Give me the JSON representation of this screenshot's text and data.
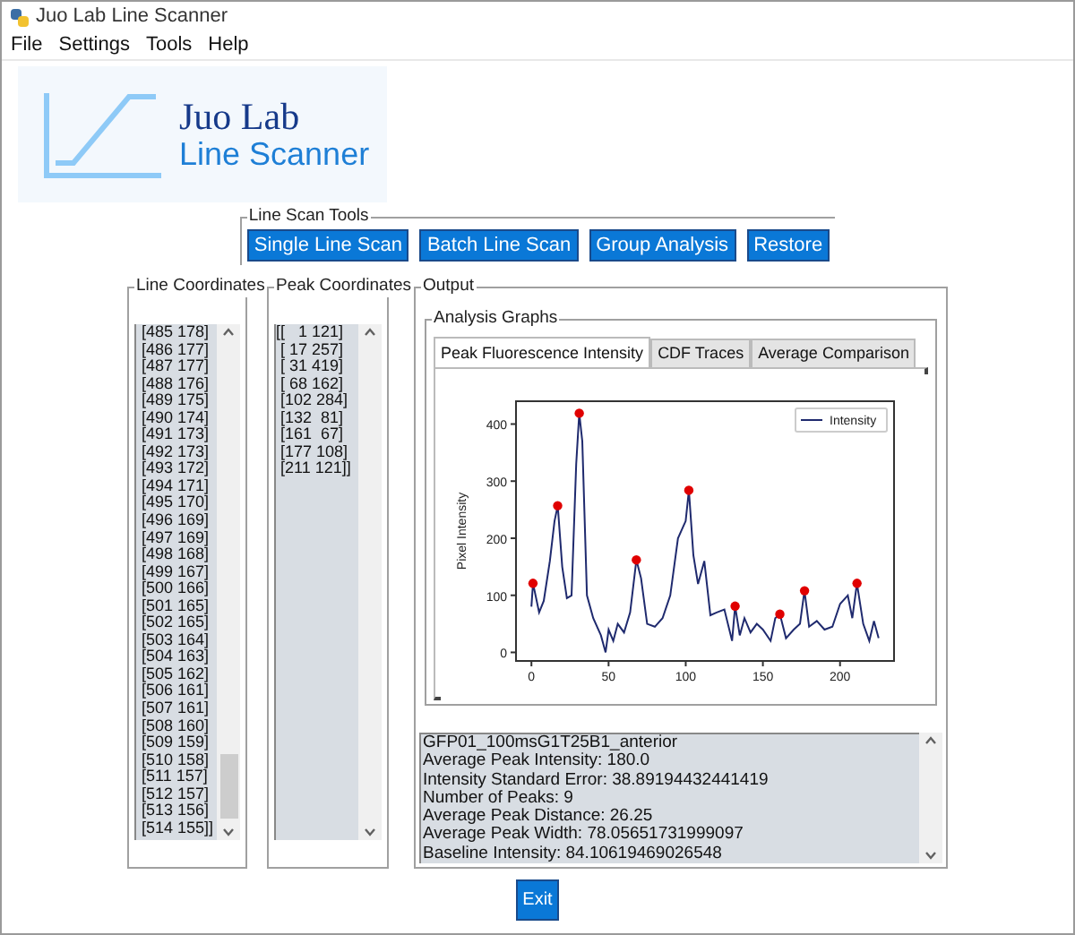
{
  "window": {
    "title": "Juo Lab Line Scanner"
  },
  "menu": [
    "File",
    "Settings",
    "Tools",
    "Help"
  ],
  "logo": {
    "title": "Juo Lab",
    "subtitle": "Line Scanner"
  },
  "tools": {
    "title": "Line Scan Tools",
    "buttons": [
      "Single Line Scan",
      "Batch Line Scan",
      "Group Analysis",
      "Restore"
    ]
  },
  "line_coordinates": {
    "title": "Line Coordinates",
    "rows": [
      "[485 178]",
      "[486 177]",
      "[487 177]",
      "[488 176]",
      "[489 175]",
      "[490 174]",
      "[491 173]",
      "[492 173]",
      "[493 172]",
      "[494 171]",
      "[495 170]",
      "[496 169]",
      "[497 169]",
      "[498 168]",
      "[499 167]",
      "[500 166]",
      "[501 165]",
      "[502 165]",
      "[503 164]",
      "[504 163]",
      "[505 162]",
      "[506 161]",
      "[507 161]",
      "[508 160]",
      "[509 159]",
      "[510 158]",
      "[511 157]",
      "[512 157]",
      "[513 156]",
      "[514 155]]"
    ]
  },
  "peak_coordinates": {
    "title": "Peak Coordinates",
    "rows": [
      "[[   1 121]",
      " [ 17 257]",
      " [ 31 419]",
      " [ 68 162]",
      " [102 284]",
      " [132  81]",
      " [161  67]",
      " [177 108]",
      " [211 121]]"
    ]
  },
  "output": {
    "title": "Output",
    "graphs_title": "Analysis Graphs",
    "tabs": [
      {
        "label": "Peak Fluorescence Intensity",
        "selected": true
      },
      {
        "label": "CDF Traces",
        "selected": false
      },
      {
        "label": "Average Comparison",
        "selected": false
      }
    ],
    "chart_data": {
      "type": "line",
      "ylabel": "Pixel Intensity",
      "xticks": [
        0,
        50,
        100,
        150,
        200
      ],
      "yticks": [
        0,
        100,
        200,
        300,
        400
      ],
      "xlim": [
        -10,
        235
      ],
      "ylim": [
        -15,
        440
      ],
      "x": [
        0,
        1,
        5,
        8,
        12,
        15,
        17,
        20,
        23,
        26,
        29,
        31,
        33,
        36,
        40,
        45,
        48,
        50,
        53,
        56,
        60,
        64,
        68,
        71,
        75,
        80,
        85,
        90,
        95,
        100,
        102,
        105,
        108,
        112,
        116,
        120,
        125,
        130,
        132,
        135,
        138,
        142,
        146,
        150,
        155,
        158,
        161,
        165,
        170,
        174,
        177,
        180,
        185,
        190,
        195,
        200,
        205,
        208,
        211,
        215,
        219,
        222,
        225
      ],
      "series": [
        {
          "name": "Intensity",
          "color": "#1f2a6e",
          "values": [
            80,
            121,
            70,
            90,
            160,
            230,
            257,
            150,
            95,
            100,
            330,
            419,
            370,
            100,
            60,
            30,
            0,
            40,
            20,
            50,
            35,
            70,
            162,
            130,
            50,
            45,
            60,
            100,
            200,
            230,
            284,
            170,
            120,
            160,
            65,
            70,
            75,
            20,
            81,
            30,
            60,
            35,
            50,
            40,
            20,
            60,
            67,
            25,
            40,
            50,
            108,
            45,
            55,
            40,
            45,
            85,
            100,
            60,
            121,
            50,
            20,
            55,
            25
          ]
        }
      ]
    },
    "results": [
      "GFP01_100msG1T25B1_anterior",
      "Average Peak Intensity: 180.0",
      "Intensity Standard Error: 38.89194432441419",
      "Number of Peaks: 9",
      "Average Peak Distance: 26.25",
      "Average Peak Width: 78.05651731999097",
      "Baseline Intensity: 84.10619469026548"
    ]
  },
  "exit_button": "Exit"
}
